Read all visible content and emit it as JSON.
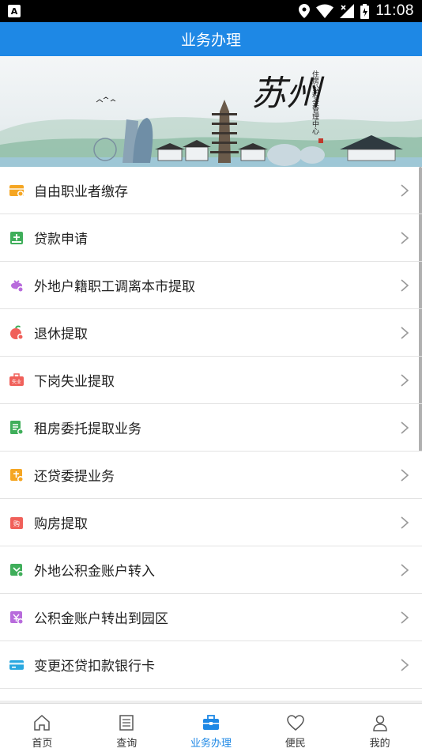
{
  "status_bar": {
    "time": "11:08"
  },
  "header": {
    "title": "业务办理"
  },
  "banner": {
    "city_text": "苏州",
    "subtitle": "住房公积金管理中心"
  },
  "menu": {
    "items": [
      {
        "label": "自由职业者缴存",
        "icon": "wallet-icon",
        "color": "#f5a623"
      },
      {
        "label": "贷款申请",
        "icon": "loan-icon",
        "color": "#3fae5a"
      },
      {
        "label": "外地户籍职工调离本市提取",
        "icon": "purse-icon",
        "color": "#b86bdc"
      },
      {
        "label": "退休提取",
        "icon": "peach-icon",
        "color": "#f0605a"
      },
      {
        "label": "下岗失业提取",
        "icon": "briefcase-icon",
        "color": "#f0605a"
      },
      {
        "label": "租房委托提取业务",
        "icon": "document-icon",
        "color": "#3fae5a"
      },
      {
        "label": "还贷委提业务",
        "icon": "card-icon",
        "color": "#f5a623"
      },
      {
        "label": "购房提取",
        "icon": "purchase-icon",
        "color": "#f0605a"
      },
      {
        "label": "外地公积金账户转入",
        "icon": "transfer-in-icon",
        "color": "#3fae5a"
      },
      {
        "label": "公积金账户转出到园区",
        "icon": "transfer-out-icon",
        "color": "#b86bdc"
      },
      {
        "label": "变更还贷扣款银行卡",
        "icon": "bank-card-icon",
        "color": "#29a8e0"
      }
    ],
    "icon_texts": {
      "briefcase": "失业",
      "purchase": "购"
    }
  },
  "bottom_nav": {
    "items": [
      {
        "label": "首页",
        "icon": "home-icon"
      },
      {
        "label": "查询",
        "icon": "list-icon"
      },
      {
        "label": "业务办理",
        "icon": "briefcase-icon",
        "active": true
      },
      {
        "label": "便民",
        "icon": "heart-icon"
      },
      {
        "label": "我的",
        "icon": "user-icon"
      }
    ],
    "active_color": "#1e88e5"
  }
}
